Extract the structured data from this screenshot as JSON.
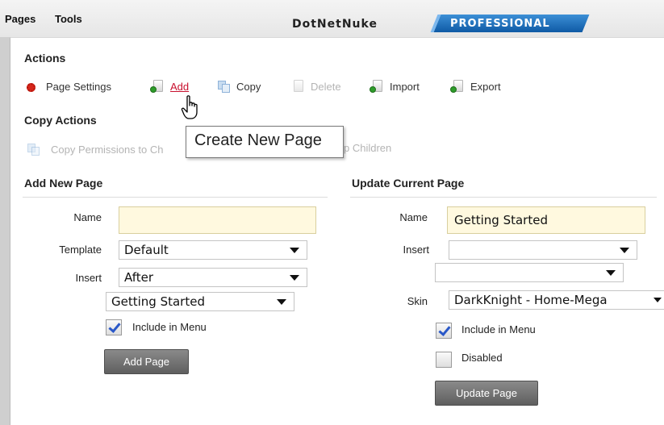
{
  "topbar": {
    "menu_pages": "Pages",
    "menu_tools": "Tools",
    "logo_main": "DotNetNuke",
    "logo_edition": "PROFESSIONAL"
  },
  "actions": {
    "title": "Actions",
    "page_settings": "Page Settings",
    "add": "Add",
    "copy": "Copy",
    "delete": "Delete",
    "import": "Import",
    "export": "Export"
  },
  "copy_actions": {
    "title": "Copy Actions",
    "copy_permissions": "Copy Permissions to Ch",
    "copy_to_children": "p Children"
  },
  "tooltip": {
    "text": "Create New Page"
  },
  "add_new_page": {
    "title": "Add New Page",
    "name_label": "Name",
    "name_value": "",
    "template_label": "Template",
    "template_value": "Default",
    "insert_label": "Insert",
    "insert_value": "After",
    "page_value": "Getting Started",
    "include_in_menu_label": "Include in Menu",
    "include_in_menu_checked": true,
    "add_button": "Add Page"
  },
  "update_current_page": {
    "title": "Update Current Page",
    "name_label": "Name",
    "name_value": "Getting Started",
    "insert_label": "Insert",
    "insert_value": "",
    "page_value": "",
    "skin_label": "Skin",
    "skin_value": "DarkKnight - Home-Mega",
    "include_in_menu_label": "Include in Menu",
    "include_in_menu_checked": true,
    "disabled_label": "Disabled",
    "disabled_checked": false,
    "update_button": "Update Page"
  },
  "colors": {
    "link_hover": "#c8102e",
    "textbox_bg": "#fff9df",
    "button_bg": "#6e6e6e",
    "logo_blue": "#1f6fbf"
  }
}
